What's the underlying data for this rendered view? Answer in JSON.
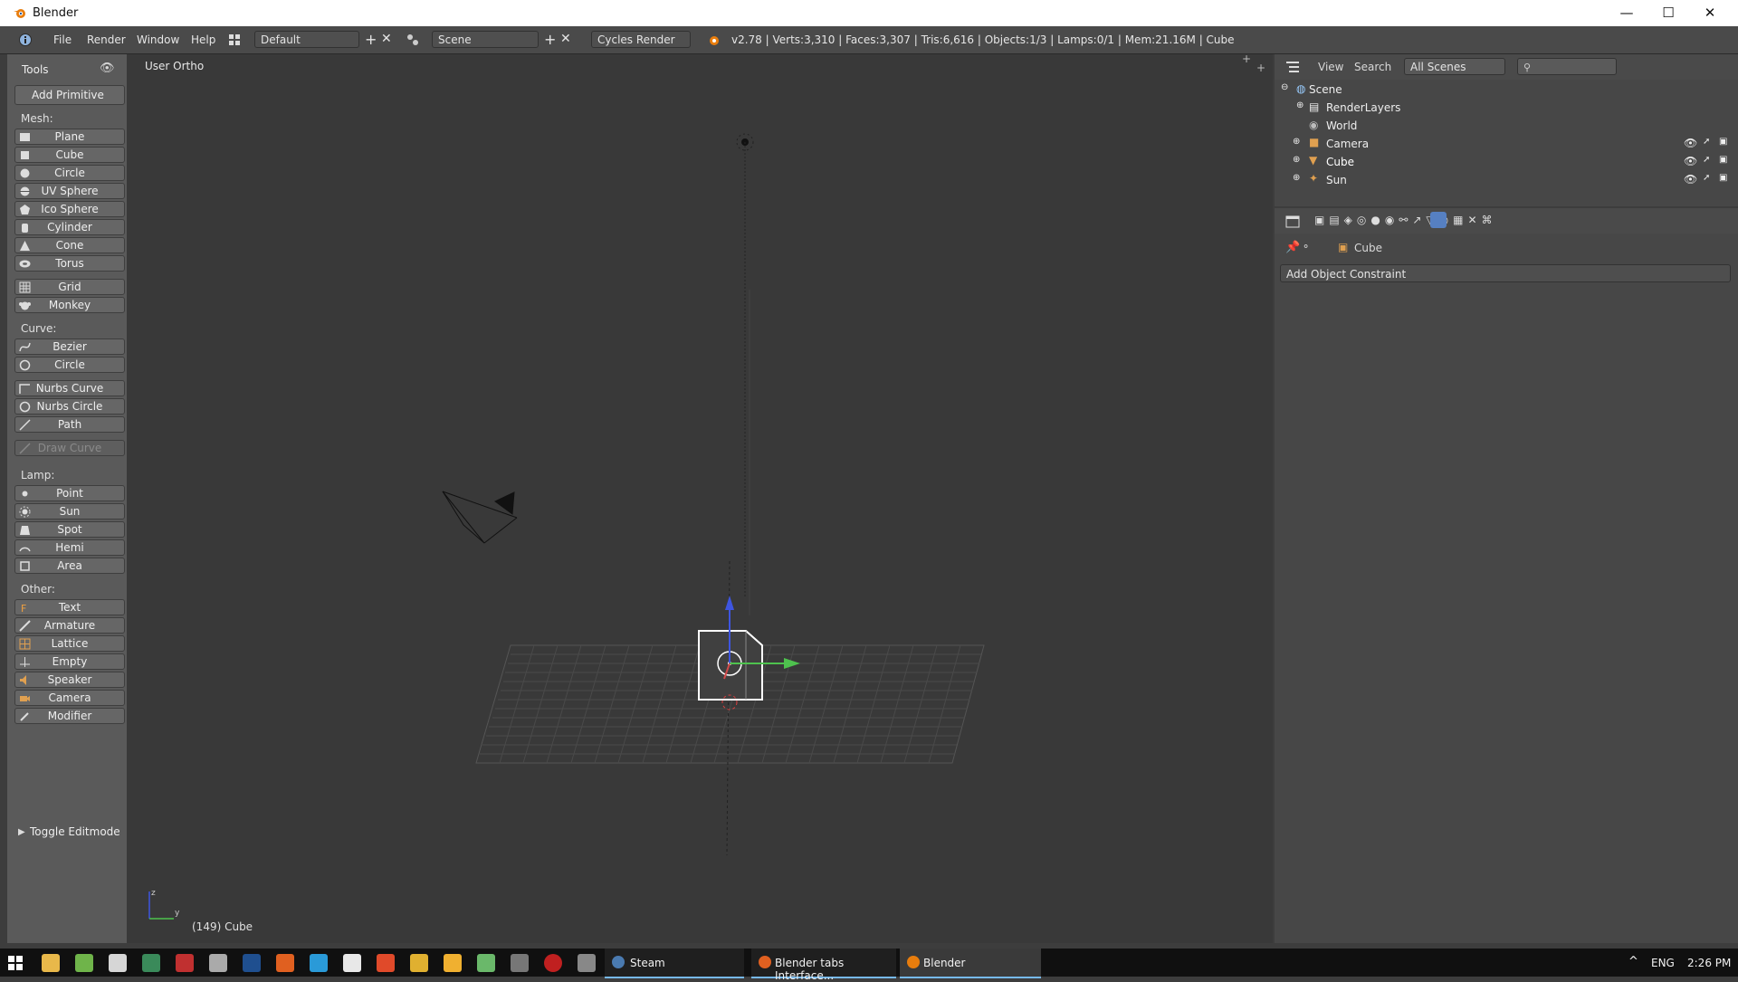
{
  "window": {
    "title": "Blender",
    "controls": [
      "—",
      "☐",
      "✕"
    ]
  },
  "menus": [
    "File",
    "Render",
    "Window",
    "Help"
  ],
  "layout": {
    "screen": "Default",
    "scene": "Scene",
    "engine": "Cycles Render"
  },
  "stats": "v2.78 | Verts:3,310 | Faces:3,307 | Tris:6,616 | Objects:1/3 | Lamps:0/1 | Mem:21.16M | Cube",
  "toolshelf": {
    "tab": "Tools",
    "add_primitive": "Add Primitive",
    "mesh_label": "Mesh:",
    "mesh": [
      "Plane",
      "Cube",
      "Circle",
      "UV Sphere",
      "Ico Sphere",
      "Cylinder",
      "Cone",
      "Torus",
      "Grid",
      "Monkey"
    ],
    "curve_label": "Curve:",
    "curve": [
      "Bezier",
      "Circle",
      "Nurbs Curve",
      "Nurbs Circle",
      "Path",
      "Draw Curve"
    ],
    "lamp_label": "Lamp:",
    "lamp": [
      "Point",
      "Sun",
      "Spot",
      "Hemi",
      "Area"
    ],
    "other_label": "Other:",
    "other": [
      "Text",
      "Armature",
      "Lattice",
      "Empty",
      "Speaker",
      "Camera",
      "Modifier"
    ],
    "toggle_editmode": "Toggle Editmode"
  },
  "viewport": {
    "view_label": "User Ortho",
    "object_label": "(149) Cube",
    "axis_z": "z",
    "axis_y": "y"
  },
  "outliner": {
    "menu_view": "View",
    "menu_search": "Search",
    "display_mode": "All Scenes",
    "items": [
      "Scene",
      "RenderLayers",
      "World",
      "Camera",
      "Cube",
      "Sun"
    ]
  },
  "properties": {
    "object_name": "Cube",
    "add_constraint": "Add Object Constraint"
  },
  "taskbar": {
    "apps": [
      "Steam",
      "Blender tabs Interface...",
      "Blender"
    ],
    "lang": "ENG",
    "time": "2:26 PM"
  },
  "colors": {
    "accent_blue": "#5680c2",
    "axis_x": "#d24a4a",
    "axis_y": "#4ec24e",
    "axis_z": "#3e55e0",
    "selection": "#ffffff"
  }
}
